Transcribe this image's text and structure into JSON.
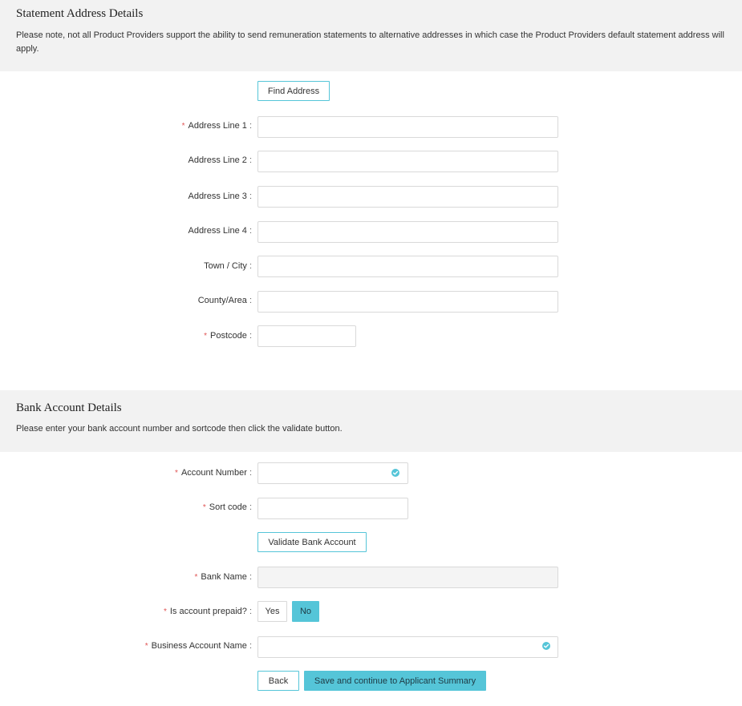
{
  "statement": {
    "title": "Statement Address Details",
    "note": "Please note, not all Product Providers support the ability to send remuneration statements to alternative addresses in which case the Product Providers default statement address will apply.",
    "find_address_label": "Find Address",
    "fields": {
      "address_line_1": {
        "label": "Address Line 1",
        "value": "",
        "required": true
      },
      "address_line_2": {
        "label": "Address Line 2",
        "value": ""
      },
      "address_line_3": {
        "label": "Address Line 3",
        "value": ""
      },
      "address_line_4": {
        "label": "Address Line 4",
        "value": ""
      },
      "town_city": {
        "label": "Town / City",
        "value": ""
      },
      "county_area": {
        "label": "County/Area",
        "value": ""
      },
      "postcode": {
        "label": "Postcode",
        "value": "",
        "required": true
      }
    }
  },
  "bank": {
    "title": "Bank Account Details",
    "note": "Please enter your bank account number and sortcode then click the validate button.",
    "fields": {
      "account_number": {
        "label": "Account Number",
        "value": "",
        "required": true
      },
      "sort_code": {
        "label": "Sort code",
        "value": "",
        "required": true
      },
      "bank_name": {
        "label": "Bank Name",
        "value": "",
        "required": true
      },
      "is_prepaid": {
        "label": "Is account prepaid?",
        "required": true,
        "options": [
          "Yes",
          "No"
        ],
        "selected": "No"
      },
      "business_account_name": {
        "label": "Business Account Name",
        "value": "",
        "required": true
      }
    },
    "validate_label": "Validate Bank Account"
  },
  "footer": {
    "back_label": "Back",
    "save_label": "Save and continue to Applicant Summary"
  },
  "colors": {
    "accent": "#55c5d8",
    "required": "#e05555",
    "header_bg": "#f2f2f2"
  },
  "required_marker": "*",
  "colon": ":",
  "icons": {
    "valid": "check-circle-icon"
  }
}
